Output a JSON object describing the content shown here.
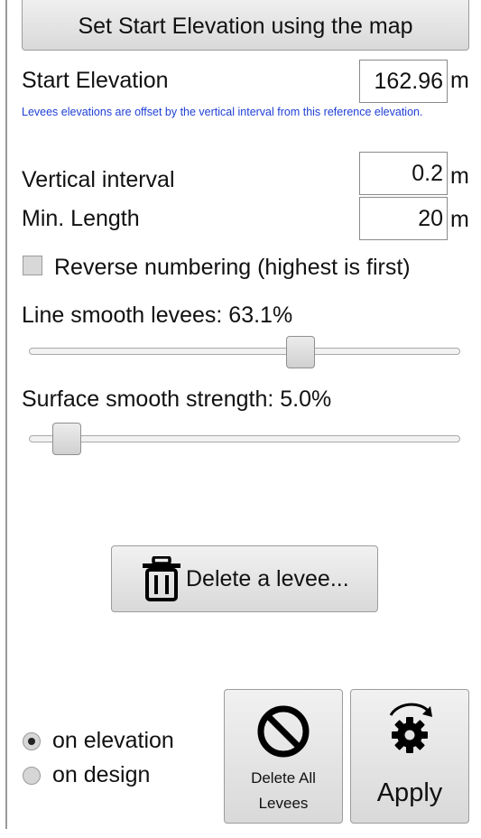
{
  "header": {
    "set_start_label": "Set Start Elevation using the map"
  },
  "start_elevation": {
    "label": "Start Elevation",
    "value": "162.96",
    "unit": "m",
    "note": "Levees elevations are offset by the vertical interval from this reference elevation."
  },
  "vertical_interval": {
    "label": "Vertical interval",
    "value": "0.2",
    "unit": "m"
  },
  "min_length": {
    "label": "Min. Length",
    "value": "20",
    "unit": "m"
  },
  "reverse_numbering": {
    "label": "Reverse numbering (highest is first)",
    "checked": false
  },
  "line_smooth": {
    "label": "Line smooth levees: 63.1%",
    "value_percent": 63.1
  },
  "surface_smooth": {
    "label": "Surface smooth strength: 5.0%",
    "value_percent": 5.0
  },
  "delete_levee": {
    "label": "Delete a levee...",
    "icon": "trash-icon"
  },
  "mode": {
    "options": [
      {
        "label": "on elevation",
        "selected": true
      },
      {
        "label": "on design",
        "selected": false
      }
    ]
  },
  "delete_all": {
    "label_line1": "Delete All",
    "label_line2": "Levees",
    "icon": "prohibited-icon"
  },
  "apply": {
    "label": "Apply",
    "icon": "gear-refresh-icon"
  }
}
